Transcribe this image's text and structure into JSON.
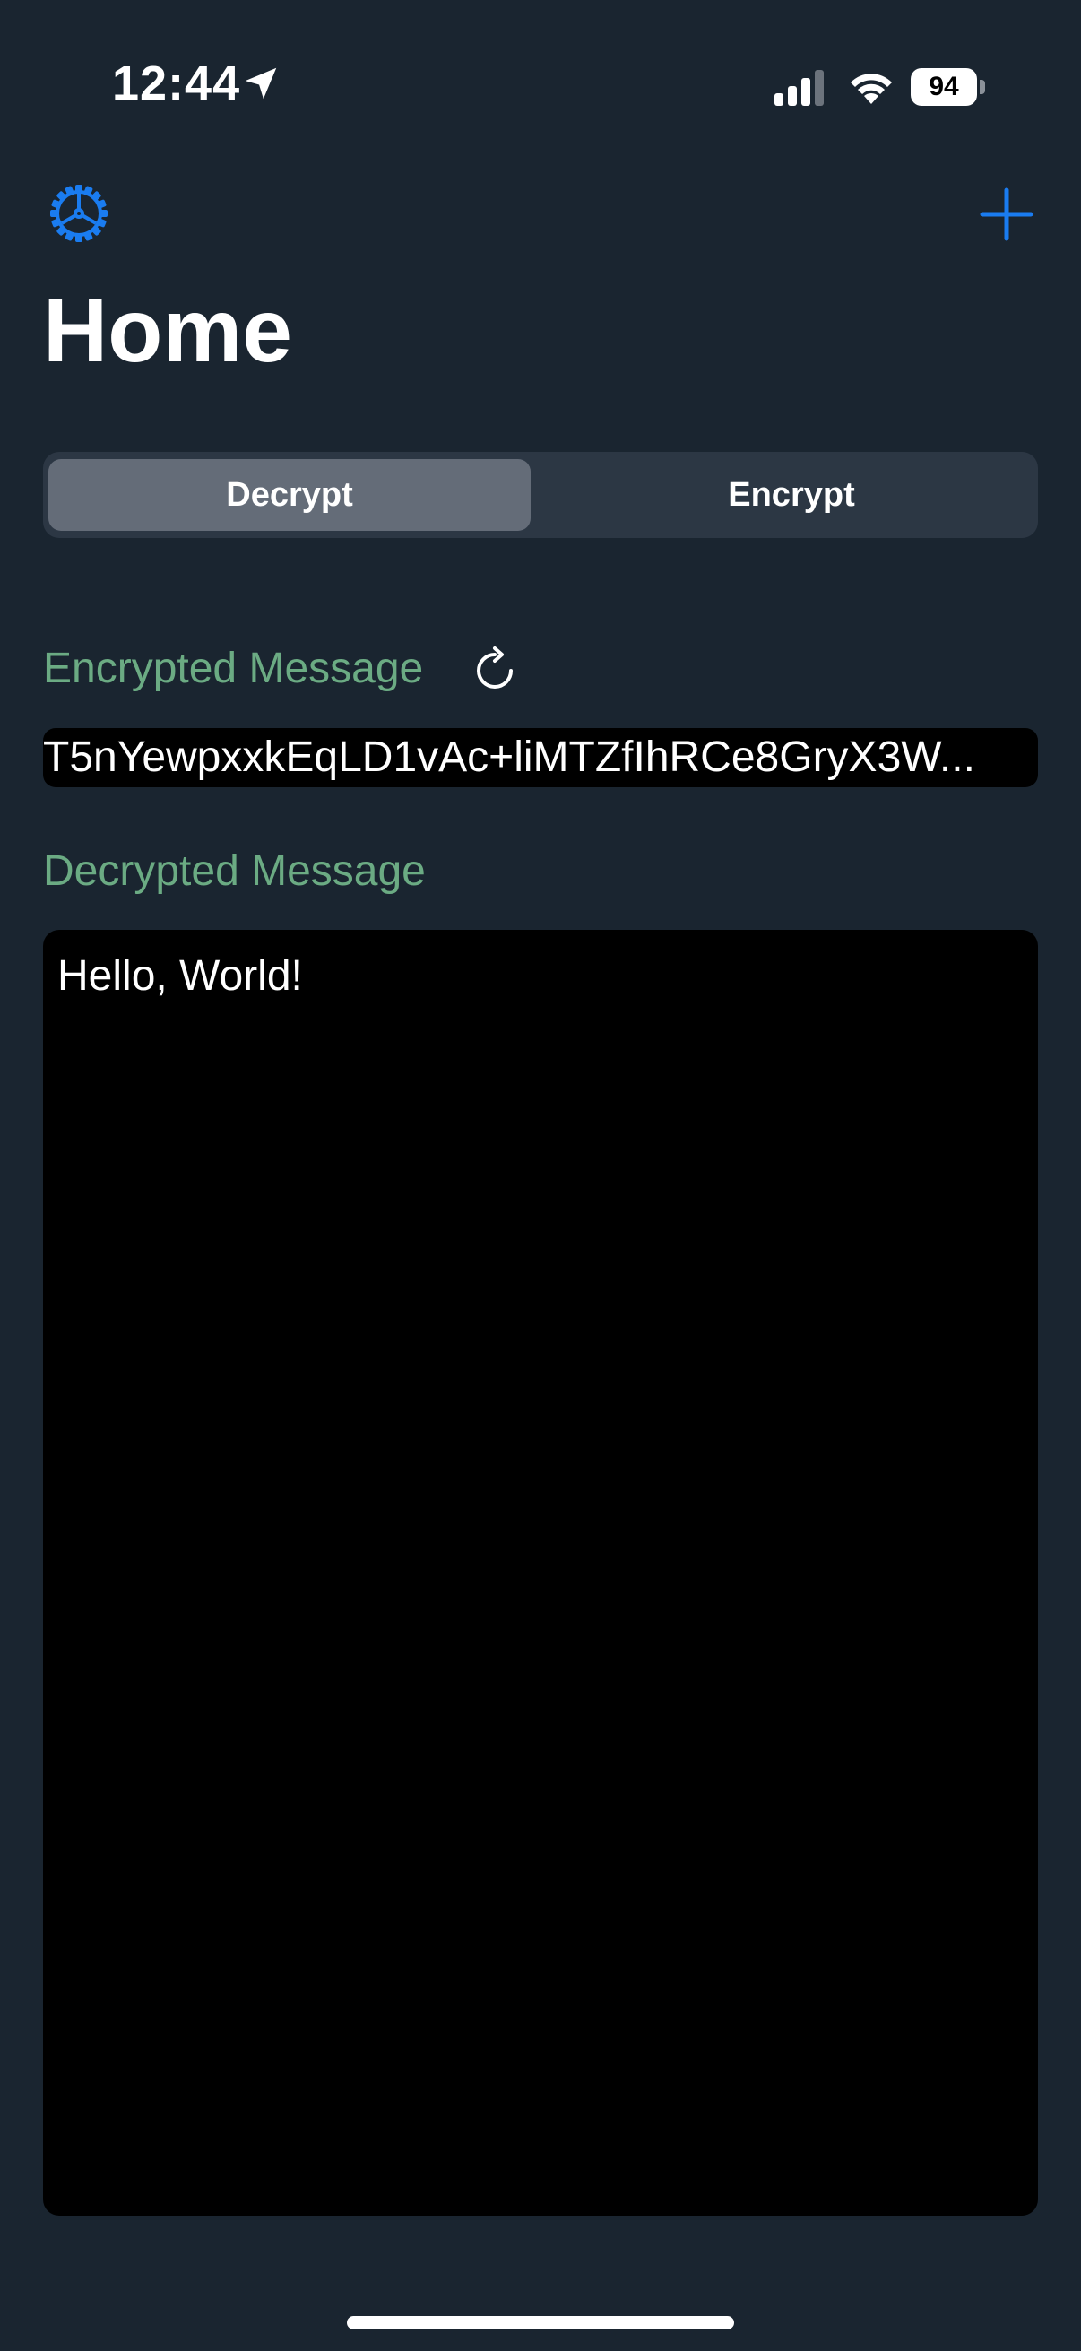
{
  "status_bar": {
    "time": "12:44",
    "battery_level": "94",
    "icons": [
      "location-arrow-icon",
      "cellular-signal-icon",
      "wifi-icon",
      "battery-icon"
    ]
  },
  "nav": {
    "settings_icon": "gear-icon",
    "add_icon": "plus-icon",
    "title": "Home"
  },
  "segmented_control": {
    "segments": [
      {
        "label": "Decrypt",
        "selected": true
      },
      {
        "label": "Encrypt",
        "selected": false
      }
    ]
  },
  "encrypted_section": {
    "label": "Encrypted Message",
    "refresh_icon": "refresh-icon",
    "value": "T5nYewpxxkEqLD1vAc+liMTZfIhRCe8GryX3W..."
  },
  "decrypted_section": {
    "label": "Decrypted Message",
    "value": "Hello, World!"
  },
  "colors": {
    "background": "#1a2530",
    "accent": "#1a7cf0",
    "label_green": "#6bab83",
    "segment_selected": "#646c78",
    "segment_track": "#2c3744",
    "field_background": "#000000"
  }
}
